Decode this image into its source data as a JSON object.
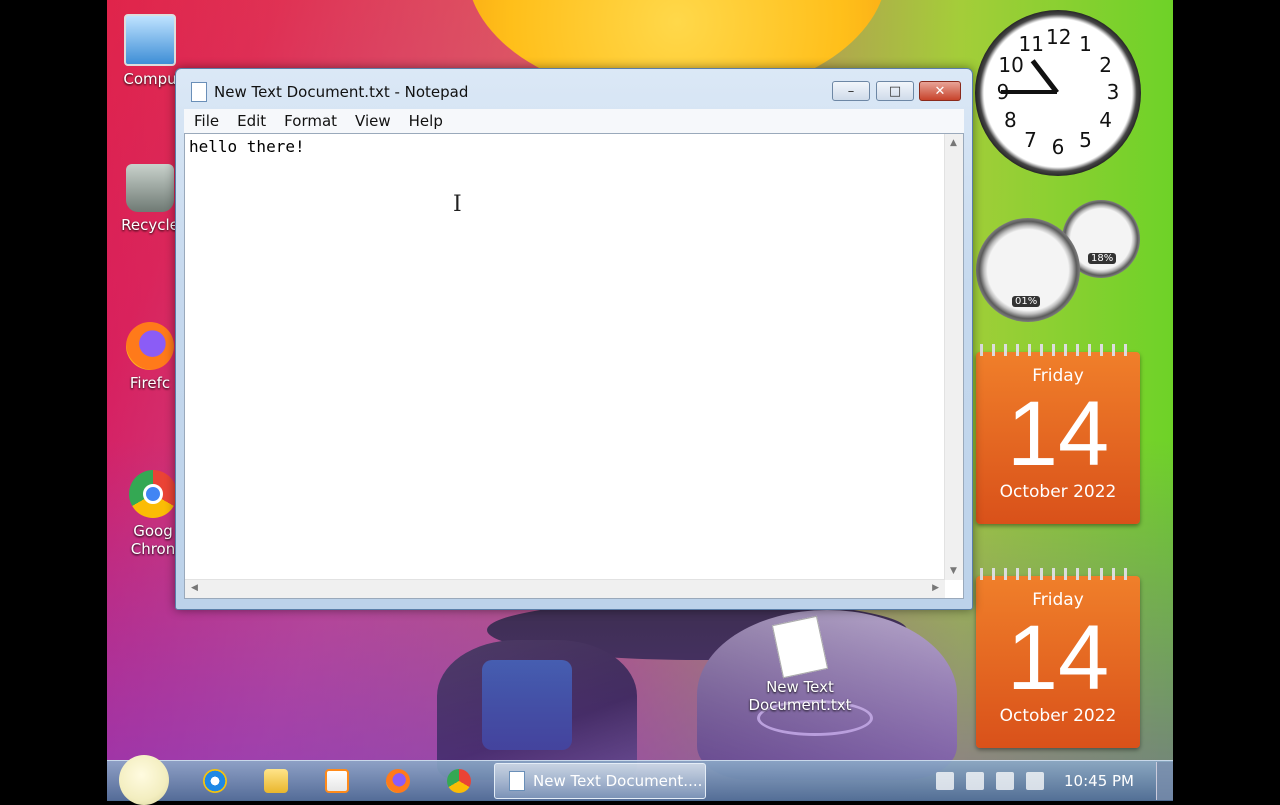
{
  "desktop": {
    "icons": [
      {
        "label": "Compu"
      },
      {
        "label": "Recycle"
      },
      {
        "label": "Firefc"
      },
      {
        "label": "Goog Chron"
      }
    ],
    "file": {
      "label": "New Text Document.txt"
    }
  },
  "notepad": {
    "title": "New Text Document.txt - Notepad",
    "controls": {
      "minimize": "–",
      "maximize": "□",
      "close": "✕"
    },
    "menu": [
      "File",
      "Edit",
      "Format",
      "View",
      "Help"
    ],
    "content": "hello there!"
  },
  "gadgets": {
    "clock": {
      "numbers": [
        "12",
        "1",
        "2",
        "3",
        "4",
        "5",
        "6",
        "7",
        "8",
        "9",
        "10",
        "11"
      ],
      "time": "10:45"
    },
    "cpu_meter": {
      "cpu": "01%",
      "memory": "18%"
    },
    "calendars": [
      {
        "day": "Friday",
        "date": "14",
        "month_year": "October 2022"
      },
      {
        "day": "Friday",
        "date": "14",
        "month_year": "October 2022"
      }
    ]
  },
  "taskbar": {
    "task_label": "New Text Document....",
    "clock": "10:45 PM"
  },
  "colors": {
    "calendar": "#e86a22",
    "close_button": "#c7432b",
    "window_frame": "#c6d9ee"
  }
}
